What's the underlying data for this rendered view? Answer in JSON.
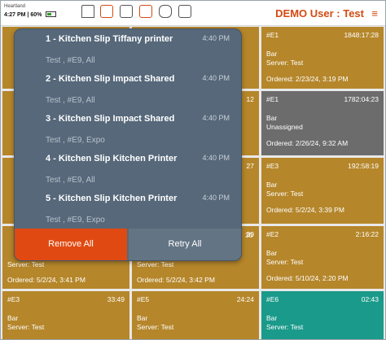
{
  "status_bar": {
    "carrier": "Heartland",
    "time": "4:27 PM",
    "battery": "60%"
  },
  "header": {
    "title": "DEMO User : Test"
  },
  "toolbar_icons": [
    "home-icon",
    "sitemap-icon",
    "folder-icon",
    "split-icon",
    "chat-icon",
    "terminal-icon"
  ],
  "tickets": [
    {
      "id": "#E1",
      "timer": "1848:17:28",
      "type": "Bar",
      "server": "Server: Test",
      "ordered": "Ordered: 2/23/24, 3:19 PM"
    },
    {
      "id": "#E1",
      "timer": "1782:04:23",
      "type": "Bar",
      "server": "Unassigned",
      "ordered": "Ordered: 2/26/24, 9:32 AM"
    },
    {
      "id": "#E3",
      "timer": "192:58:19",
      "type": "Bar",
      "server": "Server: Test",
      "ordered": "Ordered: 5/2/24, 3:39 PM"
    },
    {
      "id": "#E2",
      "timer": "2:16:22",
      "type": "Bar",
      "server": "Server: Test",
      "ordered": "Ordered: 5/10/24, 2:20 PM"
    },
    {
      "id": "",
      "timer": "",
      "type": "",
      "server": "Server: Test",
      "ordered": "Ordered: 5/2/24, 3:41 PM"
    },
    {
      "id": "",
      "timer": "",
      "type": "",
      "server": "Server: Test",
      "ordered": "Ordered: 5/2/24, 3:42 PM"
    },
    {
      "id": "#E3",
      "timer": "33:49",
      "type": "Bar",
      "server": "Server: Test",
      "ordered": ""
    },
    {
      "id": "#E5",
      "timer": "24:24",
      "type": "Bar",
      "server": "Server: Test",
      "ordered": ""
    },
    {
      "id": "#E6",
      "timer": "02:43",
      "type": "Bar",
      "server": "Server: Test",
      "ordered": ""
    }
  ],
  "partial_timers": [
    "12",
    "27",
    "30",
    "30"
  ],
  "popup": {
    "slips": [
      {
        "title": "1 - Kitchen Slip Tiffany  printer",
        "sub": "Test , #E9, All",
        "time": "4:40 PM"
      },
      {
        "title": "2 - Kitchen Slip Impact Shared",
        "sub": "Test , #E9, All",
        "time": "4:40 PM"
      },
      {
        "title": "3 - Kitchen Slip Impact Shared",
        "sub": "Test , #E9, Expo",
        "time": "4:40 PM"
      },
      {
        "title": "4 - Kitchen Slip Kitchen Printer",
        "sub": "Test , #E9, All",
        "time": "4:40 PM"
      },
      {
        "title": "5 - Kitchen Slip Kitchen Printer",
        "sub": "Test , #E9, Expo",
        "time": "4:40 PM"
      }
    ],
    "remove_all": "Remove All",
    "retry_all": "Retry All"
  },
  "colors": {
    "accent": "#d44a12",
    "mustard": "#b5862a",
    "grey": "#6c6c6c",
    "teal": "#1a9a8a",
    "popup": "#56687a"
  }
}
